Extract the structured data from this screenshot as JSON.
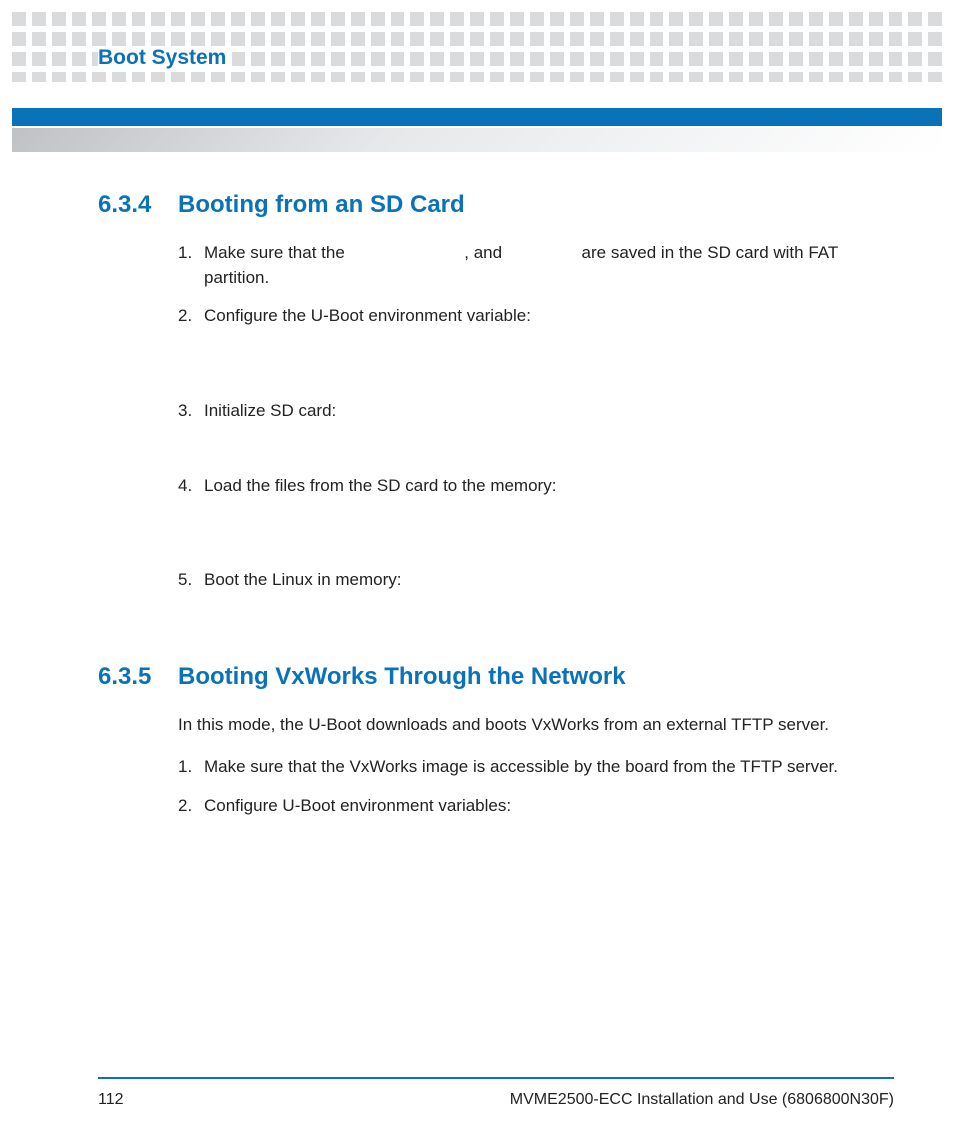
{
  "header": {
    "chapter_title": "Boot System"
  },
  "sections": [
    {
      "number": "6.3.4",
      "title": "Booting from an SD Card",
      "intro": "",
      "steps": [
        {
          "num": "1.",
          "parts": [
            "Make sure that the ",
            ", and ",
            "are saved in the SD card with FAT partition."
          ]
        },
        {
          "num": "2.",
          "parts": [
            "Configure the U-Boot environment variable:"
          ]
        },
        {
          "num": "3.",
          "parts": [
            "Initialize SD card:"
          ]
        },
        {
          "num": "4.",
          "parts": [
            "Load the files from the SD card to the memory:"
          ]
        },
        {
          "num": "5.",
          "parts": [
            "Boot the Linux in memory:"
          ]
        }
      ]
    },
    {
      "number": "6.3.5",
      "title": "Booting VxWorks Through the Network",
      "intro": "In this mode, the U-Boot downloads and boots VxWorks from an external TFTP server.",
      "steps": [
        {
          "num": "1.",
          "parts": [
            "Make sure that the VxWorks image is accessible by the board from the TFTP server."
          ]
        },
        {
          "num": "2.",
          "parts": [
            "Configure U-Boot environment variables:"
          ]
        }
      ]
    }
  ],
  "footer": {
    "page_number": "112",
    "doc_title": "MVME2500-ECC Installation and Use (6806800N30F)"
  }
}
